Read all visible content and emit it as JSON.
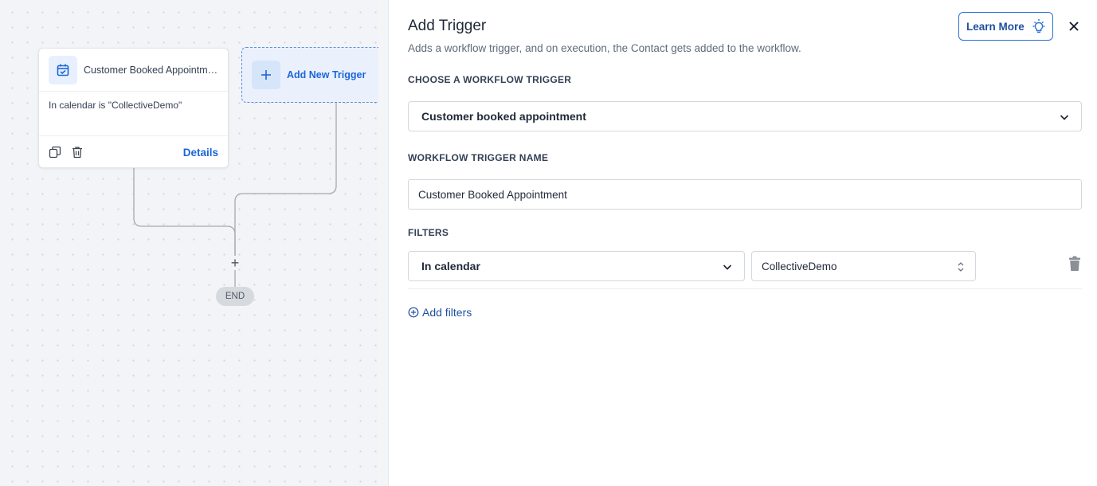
{
  "canvas": {
    "trigger_card": {
      "title": "Customer Booked Appointme...",
      "condition": "In calendar is \"CollectiveDemo\"",
      "details_label": "Details"
    },
    "add_trigger_label": "Add New Trigger",
    "add_step_symbol": "+",
    "end_label": "END"
  },
  "drawer": {
    "title": "Add Trigger",
    "subtitle": "Adds a workflow trigger, and on execution, the Contact gets added to the workflow.",
    "learn_more_label": "Learn More",
    "choose_trigger_label": "CHOOSE A WORKFLOW TRIGGER",
    "selected_trigger": "Customer booked appointment",
    "trigger_name_label": "WORKFLOW TRIGGER NAME",
    "trigger_name_value": "Customer Booked Appointment",
    "filters_label": "FILTERS",
    "filters": [
      {
        "field": "In calendar",
        "value": "CollectiveDemo"
      }
    ],
    "add_filters_label": "Add filters"
  },
  "colors": {
    "accent": "#1a66d9",
    "canvas_bg": "#f3f4f7",
    "end_pill": "#d6d9de"
  },
  "icons": {
    "trigger_card": "calendar-check-icon",
    "copy": "copy-icon",
    "delete": "trash-icon",
    "learn_more": "lightbulb-icon",
    "close": "close-icon",
    "dropdown": "chevron-down-icon",
    "value_select": "chevron-up-down-icon",
    "add_filter": "circle-plus-icon"
  }
}
